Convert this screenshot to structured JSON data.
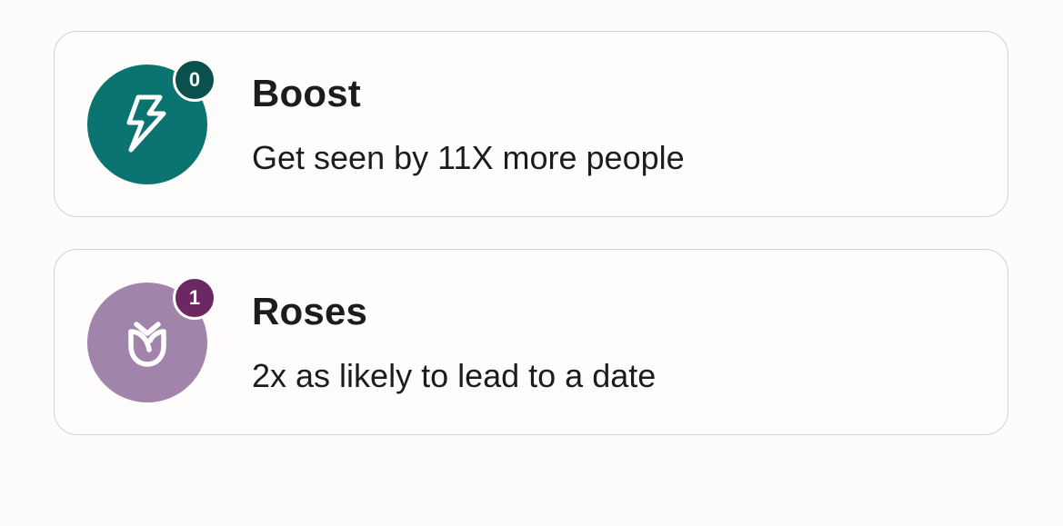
{
  "cards": [
    {
      "title": "Boost",
      "description": "Get seen by 11X more people",
      "badge_count": "0",
      "icon": "lightning-bolt-icon",
      "circle_color": "#0c7470",
      "badge_color": "#0a504c"
    },
    {
      "title": "Roses",
      "description": "2x as likely to lead to a date",
      "badge_count": "1",
      "icon": "rose-icon",
      "circle_color": "#a084aa",
      "badge_color": "#6b2863"
    }
  ]
}
